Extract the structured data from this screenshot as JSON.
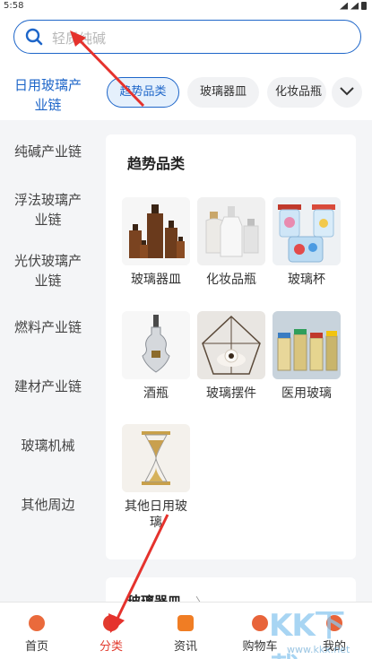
{
  "status": {
    "time": "5:58"
  },
  "search": {
    "placeholder": "轻质纯碱"
  },
  "sidebar": {
    "items": [
      {
        "label": "日用玻璃产业链"
      },
      {
        "label": "纯碱产业链"
      },
      {
        "label": "浮法玻璃产业链"
      },
      {
        "label": "光伏玻璃产业链"
      },
      {
        "label": "燃料产业链"
      },
      {
        "label": "建材产业链"
      },
      {
        "label": "玻璃机械"
      },
      {
        "label": "其他周边"
      }
    ]
  },
  "chips": [
    {
      "label": "趋势品类"
    },
    {
      "label": "玻璃器皿"
    },
    {
      "label": "化妆品瓶"
    }
  ],
  "section": {
    "title": "趋势品类",
    "items": [
      {
        "label": "玻璃器皿",
        "icon": "brown-glass-bottles"
      },
      {
        "label": "化妆品瓶",
        "icon": "cosmetic-bottles"
      },
      {
        "label": "玻璃杯",
        "icon": "glass-jars"
      },
      {
        "label": "酒瓶",
        "icon": "liquor-bottle"
      },
      {
        "label": "玻璃摆件",
        "icon": "glass-terrarium"
      },
      {
        "label": "医用玻璃",
        "icon": "medical-vials"
      },
      {
        "label": "其他日用玻璃",
        "icon": "hourglass"
      }
    ]
  },
  "section2": {
    "title": "玻璃器皿",
    "chevron": "〉"
  },
  "bottom_nav": [
    {
      "label": "首页",
      "icon": "home-icon",
      "color": "#e8643a"
    },
    {
      "label": "分类",
      "icon": "category-icon",
      "color": "#e23b2e"
    },
    {
      "label": "资讯",
      "icon": "news-icon",
      "color": "#f07d24"
    },
    {
      "label": "购物车",
      "icon": "cart-icon",
      "color": "#e8643a"
    },
    {
      "label": "我的",
      "icon": "profile-icon",
      "color": "#e8643a"
    }
  ],
  "watermark": {
    "text": "KK下载",
    "url": "www.kkx.net"
  },
  "colors": {
    "accent": "#1e66c9",
    "active_tab": "#e23b2e",
    "annotation_arrow": "#e5322d"
  }
}
